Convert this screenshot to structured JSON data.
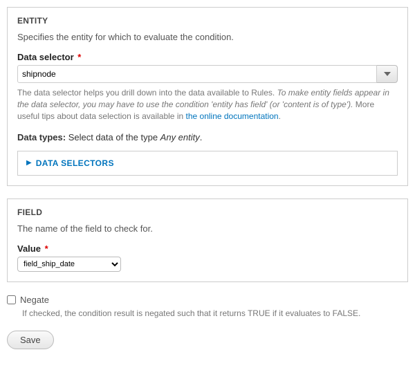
{
  "entity": {
    "title": "ENTITY",
    "description": "Specifies the entity for which to evaluate the condition.",
    "selector_label": "Data selector",
    "selector_value": "shipnode",
    "help_before": "The data selector helps you drill down into the data available to Rules. ",
    "help_italic": "To make entity fields appear in the data selector, you may have to use the condition 'entity has field' (or 'content is of type').",
    "help_after": " More useful tips about data selection is available in ",
    "help_link_text": "the online documentation",
    "datatypes_label": "Data types:",
    "datatypes_text": " Select data of the type ",
    "datatypes_type": "Any entity",
    "selectors_toggle": "DATA SELECTORS"
  },
  "field": {
    "title": "FIELD",
    "description": "The name of the field to check for.",
    "value_label": "Value",
    "value_selected": "field_ship_date"
  },
  "negate": {
    "label": "Negate",
    "help": "If checked, the condition result is negated such that it returns TRUE if it evaluates to FALSE."
  },
  "actions": {
    "save": "Save"
  }
}
